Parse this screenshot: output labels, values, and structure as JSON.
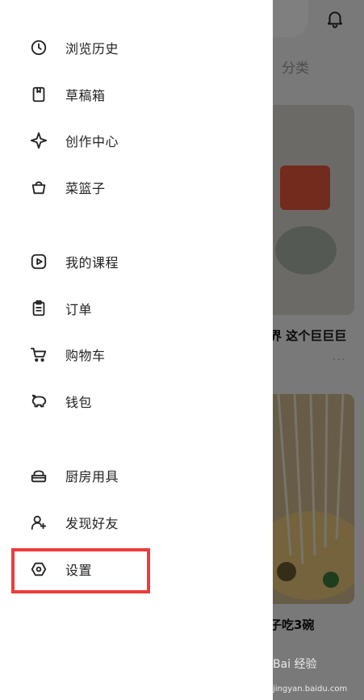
{
  "background_app": {
    "tab_label": "分类",
    "card1_title": "界 这个巨巨巨",
    "card2_title": "子吃3碗"
  },
  "drawer": {
    "items": [
      {
        "label": "浏览历史",
        "icon": "clock-icon"
      },
      {
        "label": "草稿箱",
        "icon": "draft-icon"
      },
      {
        "label": "创作中心",
        "icon": "sparkle-icon"
      },
      {
        "label": "菜篮子",
        "icon": "basket-icon"
      },
      {
        "label": "我的课程",
        "icon": "play-course-icon"
      },
      {
        "label": "订单",
        "icon": "clipboard-icon"
      },
      {
        "label": "购物车",
        "icon": "cart-icon"
      },
      {
        "label": "钱包",
        "icon": "piggy-bank-icon"
      },
      {
        "label": "厨房用具",
        "icon": "kitchen-tool-icon"
      },
      {
        "label": "发现好友",
        "icon": "add-friend-icon"
      },
      {
        "label": "设置",
        "icon": "settings-icon"
      }
    ]
  },
  "watermark": {
    "line1": "Bai 经验",
    "line2": "jingyan.baidu.com"
  },
  "colors": {
    "highlight": "#ef3b3b",
    "overlay": "rgba(0,0,0,0.5)"
  }
}
